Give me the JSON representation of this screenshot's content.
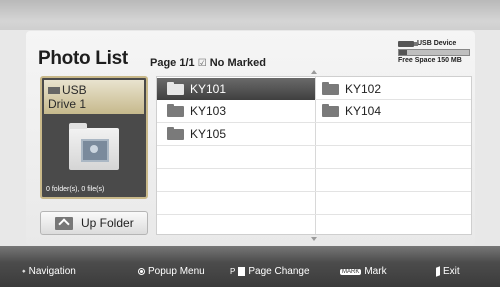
{
  "header": {
    "title": "Photo List",
    "page_info": "Page 1/1",
    "marked_status": "No Marked"
  },
  "device": {
    "name": "USB Device",
    "free_space": "Free Space 150 MB"
  },
  "drive": {
    "name_line1": "USB",
    "name_line2": "Drive 1",
    "count": "0 folder(s), 0 file(s)"
  },
  "up_folder": {
    "label": "Up Folder"
  },
  "folders": [
    {
      "name": "KY101",
      "selected": true
    },
    {
      "name": "KY102",
      "selected": false
    },
    {
      "name": "KY103",
      "selected": false
    },
    {
      "name": "KY104",
      "selected": false
    },
    {
      "name": "KY105",
      "selected": false
    }
  ],
  "footer": {
    "navigation": "Navigation",
    "popup_menu": "Popup Menu",
    "page_key": "P",
    "page_change": "Page Change",
    "mark_key": "MARK",
    "mark": "Mark",
    "exit": "Exit"
  }
}
